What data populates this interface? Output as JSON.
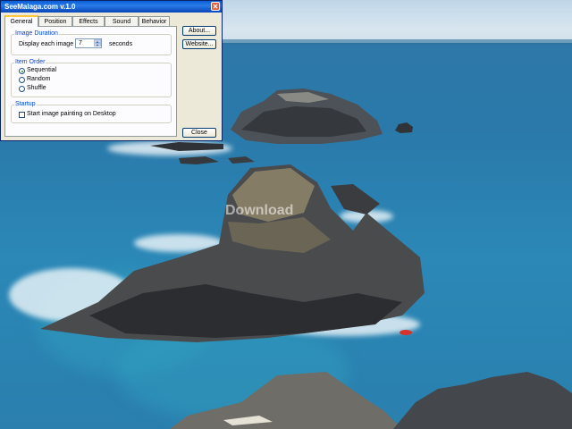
{
  "window": {
    "title": "SeeMalaga.com v.1.0",
    "close_glyph": "✕"
  },
  "tabs": [
    {
      "label": "General",
      "active": true
    },
    {
      "label": "Position"
    },
    {
      "label": "Effects"
    },
    {
      "label": "Sound"
    },
    {
      "label": "Behavior"
    }
  ],
  "image_duration": {
    "legend": "Image Duration",
    "label": "Display each image for",
    "value": "7",
    "unit": "seconds"
  },
  "item_order": {
    "legend": "Item Order",
    "options": [
      {
        "label": "Sequential",
        "selected": true
      },
      {
        "label": "Random",
        "selected": false
      },
      {
        "label": "Shuffle",
        "selected": false
      }
    ]
  },
  "startup": {
    "legend": "Startup",
    "checkbox_label": "Start image painting on Desktop",
    "checked": false
  },
  "buttons": {
    "about": "About...",
    "website": "Website...",
    "close": "Close"
  },
  "watermark": "Download",
  "colors": {
    "title_bar": "#0a5fd8",
    "dialog_face": "#ece9d8",
    "legend_text": "#0046d5",
    "sea": "#2a7fae"
  }
}
